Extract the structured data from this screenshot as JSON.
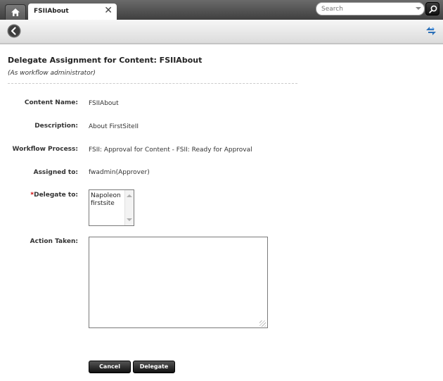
{
  "tabs": {
    "home_icon": "home-icon",
    "active_tab_label": "FSIIAbout",
    "close_icon": "close-icon"
  },
  "search": {
    "placeholder": "Search"
  },
  "toolbar": {
    "back_icon": "back-arrow-icon",
    "refresh_icon": "refresh-icon"
  },
  "page": {
    "title": "Delegate Assignment for Content: FSIIAbout",
    "subtitle": "(As workflow administrator)"
  },
  "form": {
    "content_name": {
      "label": "Content Name:",
      "value": "FSIIAbout"
    },
    "description": {
      "label": "Description:",
      "value": "About FirstSiteII"
    },
    "workflow_process": {
      "label": "Workflow Process:",
      "value": "FSII: Approval for Content - FSII: Ready for Approval"
    },
    "assigned_to": {
      "label": "Assigned to:",
      "value": "fwadmin(Approver)"
    },
    "delegate_to": {
      "required_mark": "*",
      "label": "Delegate to:",
      "options": [
        "Napoleon",
        "firstsite"
      ]
    },
    "action_taken": {
      "label": "Action Taken:",
      "value": ""
    }
  },
  "buttons": {
    "cancel": "Cancel",
    "delegate": "Delegate"
  },
  "colors": {
    "required": "#cc0000",
    "button_bg": "#222222"
  }
}
